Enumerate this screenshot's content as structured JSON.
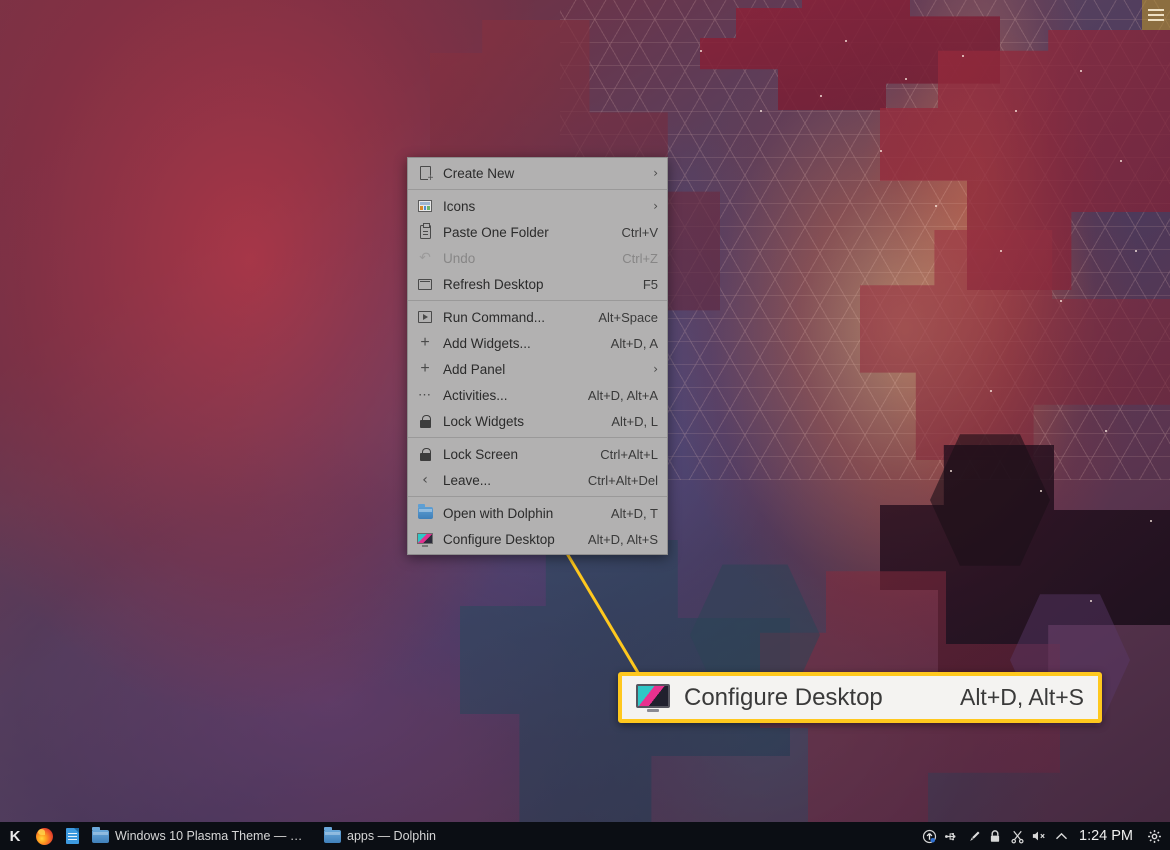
{
  "desktop": {
    "corner_button": {
      "name": "hamburger-menu",
      "label": ""
    }
  },
  "context_menu": {
    "groups": [
      {
        "items": [
          {
            "icon": "new-document-icon",
            "label": "Create New",
            "shortcut": "",
            "submenu": true,
            "disabled": false
          }
        ]
      },
      {
        "items": [
          {
            "icon": "icons-grid-icon",
            "label": "Icons",
            "shortcut": "",
            "submenu": true,
            "disabled": false
          },
          {
            "icon": "clipboard-paste-icon",
            "label": "Paste One Folder",
            "shortcut": "Ctrl+V",
            "submenu": false,
            "disabled": false
          },
          {
            "icon": "undo-icon",
            "label": "Undo",
            "shortcut": "Ctrl+Z",
            "submenu": false,
            "disabled": true
          },
          {
            "icon": "refresh-desktop-icon",
            "label": "Refresh Desktop",
            "shortcut": "F5",
            "submenu": false,
            "disabled": false
          }
        ]
      },
      {
        "items": [
          {
            "icon": "run-command-icon",
            "label": "Run Command...",
            "shortcut": "Alt+Space",
            "submenu": false,
            "disabled": false
          },
          {
            "icon": "plus-icon",
            "label": "Add Widgets...",
            "shortcut": "Alt+D, A",
            "submenu": false,
            "disabled": false
          },
          {
            "icon": "plus-icon",
            "label": "Add Panel",
            "shortcut": "",
            "submenu": true,
            "disabled": false
          },
          {
            "icon": "activities-dots-icon",
            "label": "Activities...",
            "shortcut": "Alt+D, Alt+A",
            "submenu": false,
            "disabled": false
          },
          {
            "icon": "lock-icon",
            "label": "Lock Widgets",
            "shortcut": "Alt+D, L",
            "submenu": false,
            "disabled": false
          }
        ]
      },
      {
        "items": [
          {
            "icon": "lock-icon",
            "label": "Lock Screen",
            "shortcut": "Ctrl+Alt+L",
            "submenu": false,
            "disabled": false
          },
          {
            "icon": "leave-chevron-icon",
            "label": "Leave...",
            "shortcut": "Ctrl+Alt+Del",
            "submenu": false,
            "disabled": false
          }
        ]
      },
      {
        "items": [
          {
            "icon": "folder-icon",
            "label": "Open with Dolphin",
            "shortcut": "Alt+D, T",
            "submenu": false,
            "disabled": false
          },
          {
            "icon": "monitor-icon",
            "label": "Configure Desktop",
            "shortcut": "Alt+D, Alt+S",
            "submenu": false,
            "disabled": false
          }
        ]
      }
    ]
  },
  "callout": {
    "icon": "monitor-icon",
    "label": "Configure Desktop",
    "shortcut": "Alt+D, Alt+S",
    "border_color": "#ffc81e",
    "background_color": "#f4f3f1"
  },
  "taskbar": {
    "launcher": {
      "icon": "kde-logo-icon",
      "label": "K"
    },
    "pinned": [
      {
        "icon": "firefox-icon",
        "label": "Firefox"
      },
      {
        "icon": "document-icon",
        "label": "Document"
      }
    ],
    "tasks": [
      {
        "icon": "folder-icon",
        "title": "Windows 10 Plasma Theme — Do..."
      },
      {
        "icon": "folder-icon",
        "title": "apps — Dolphin"
      }
    ],
    "tray": [
      {
        "icon": "software-update-icon",
        "glyph": "⬆"
      },
      {
        "icon": "usb-icon",
        "glyph": "⚯"
      },
      {
        "icon": "brush-icon",
        "glyph": "✎"
      },
      {
        "icon": "lock-icon",
        "glyph": "🔒"
      },
      {
        "icon": "scissors-icon",
        "glyph": "✂"
      },
      {
        "icon": "volume-muted-icon",
        "glyph": "🔇"
      },
      {
        "icon": "chevron-up-icon",
        "glyph": "︿"
      }
    ],
    "clock": "1:24 PM",
    "settings": {
      "icon": "gear-icon",
      "glyph": "⚙"
    }
  }
}
